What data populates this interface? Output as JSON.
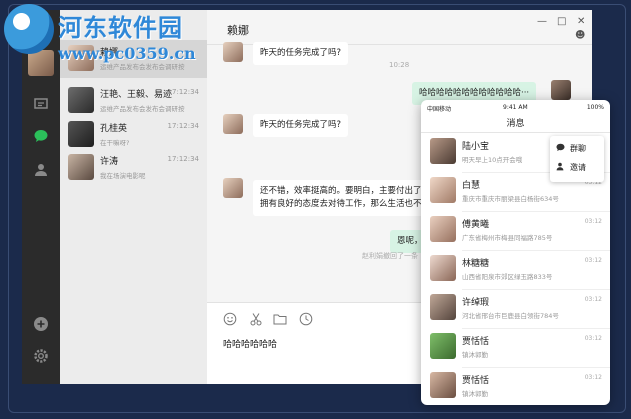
{
  "watermark": {
    "title": "河东软件园",
    "url": "www.pc0359.cn"
  },
  "sidebar": {
    "icons": [
      "chat-list-icon",
      "chat-bubble-icon",
      "contacts-icon",
      "add-icon",
      "settings-icon"
    ],
    "accent": "#2bbf5a"
  },
  "chat_list": [
    {
      "name": "赖娜",
      "time": "",
      "preview": "运维产品发布会发布会调研按",
      "active": true
    },
    {
      "name": "汪艳、王毅、易迹",
      "time": "17:12:34",
      "preview": "运维产品发布会发布会调研按",
      "active": false
    },
    {
      "name": "孔桂英",
      "time": "17:12:34",
      "preview": "在干嘛呀?",
      "active": false
    },
    {
      "name": "许涛",
      "time": "17:12:34",
      "preview": "我在场演电影呢",
      "active": false
    }
  ],
  "conversation": {
    "title": "赖娜",
    "messages": [
      {
        "from": "other",
        "text": "昨天的任务完成了吗?"
      },
      {
        "type": "time",
        "text": "10:28"
      },
      {
        "from": "me",
        "text": "哈哈哈哈哈哈哈哈哈哈哈哈···"
      },
      {
        "from": "other",
        "text": "昨天的任务完成了吗?"
      },
      {
        "from": "other",
        "text": "还不错，效率挺高的。要明白，主要付出了时",
        "line2": "拥有良好的态度去对待工作，那么生活也不会"
      },
      {
        "from": "me",
        "text": "恩呢，我都明"
      },
      {
        "type": "system",
        "text": "赵利娟撤回了一条"
      }
    ],
    "input_value": "哈哈哈哈哈哈",
    "toolbar": [
      "emoji-icon",
      "scissors-icon",
      "folder-icon",
      "clock-icon"
    ]
  },
  "phone": {
    "carrier": "中国移动",
    "clock": "9:41 AM",
    "battery": "100%",
    "title": "消息",
    "popup": [
      {
        "icon": "chat-bubble-icon",
        "label": "群聊"
      },
      {
        "icon": "add-user-icon",
        "label": "邀请"
      }
    ],
    "contacts": [
      {
        "name": "陆小宝",
        "sub": "明天早上10点开会哦",
        "time": ""
      },
      {
        "name": "白慧",
        "sub": "重庆市重庆市丽梁县白杨街634号",
        "time": "03:12"
      },
      {
        "name": "傅黄曦",
        "sub": "广东省梅州市梅县同福路785号",
        "time": "03:12"
      },
      {
        "name": "林糖糖",
        "sub": "山西省阳泉市郊区绿玉路833号",
        "time": "03:12"
      },
      {
        "name": "许绰瑕",
        "sub": "河北省邢台市巨鹿县白领街784号",
        "time": "03:12"
      },
      {
        "name": "贾恬恬",
        "sub": "镇沐郭勤",
        "time": "03:12"
      },
      {
        "name": "贾恬恬",
        "sub": "镇沐郭勤",
        "time": "03:12"
      }
    ]
  }
}
